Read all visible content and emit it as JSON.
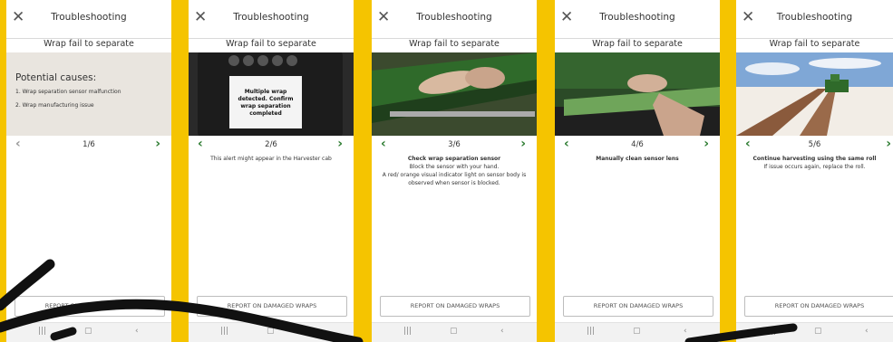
{
  "screens": [
    {
      "header_title": "Troubleshooting",
      "subtitle": "Wrap fail to separate",
      "causes_title": "Potential causes:",
      "causes": [
        "1. Wrap separation sensor malfunction",
        "2. Wrap manufacturing issue"
      ],
      "page": "1/6",
      "desc_title": "",
      "desc_lines": [],
      "report_label": "REPORT ON DAMAGED WRAPS"
    },
    {
      "header_title": "Troubleshooting",
      "subtitle": "Wrap fail to separate",
      "display_message": "Multiple wrap detected. Confirm wrap separation completed",
      "page": "2/6",
      "desc_title": "",
      "desc_lines": [
        "This alert might appear in the Harvester cab"
      ],
      "report_label": "REPORT ON DAMAGED WRAPS"
    },
    {
      "header_title": "Troubleshooting",
      "subtitle": "Wrap fail to separate",
      "page": "3/6",
      "desc_title": "Check wrap separation sensor",
      "desc_lines": [
        "Block the sensor with your hand.",
        "A red/ orange visual indicator light on sensor body is observed when sensor is blocked."
      ],
      "report_label": "REPORT ON DAMAGED WRAPS"
    },
    {
      "header_title": "Troubleshooting",
      "subtitle": "Wrap fail to separate",
      "page": "4/6",
      "desc_title": "Manually clean sensor lens",
      "desc_lines": [],
      "report_label": "REPORT ON DAMAGED WRAPS"
    },
    {
      "header_title": "Troubleshooting",
      "subtitle": "Wrap fail to separate",
      "page": "5/6",
      "desc_title": "Continue harvesting using the same roll",
      "desc_lines": [
        "If issue occurs again, replace the roll."
      ],
      "report_label": "REPORT ON DAMAGED WRAPS"
    }
  ],
  "icons": {
    "close": "close-icon",
    "prev": "chevron-left-icon",
    "next": "chevron-right-icon",
    "nav_recent": "recent-apps-icon",
    "nav_home": "home-icon",
    "nav_back": "back-icon"
  },
  "colors": {
    "background": "#f5c400",
    "accent_green": "#2e7d32",
    "cab_display": "#1c1c1c",
    "equipment_green": "#2f6a2a",
    "field_cotton": "#f2ede6",
    "sky": "#7fa7d6"
  }
}
